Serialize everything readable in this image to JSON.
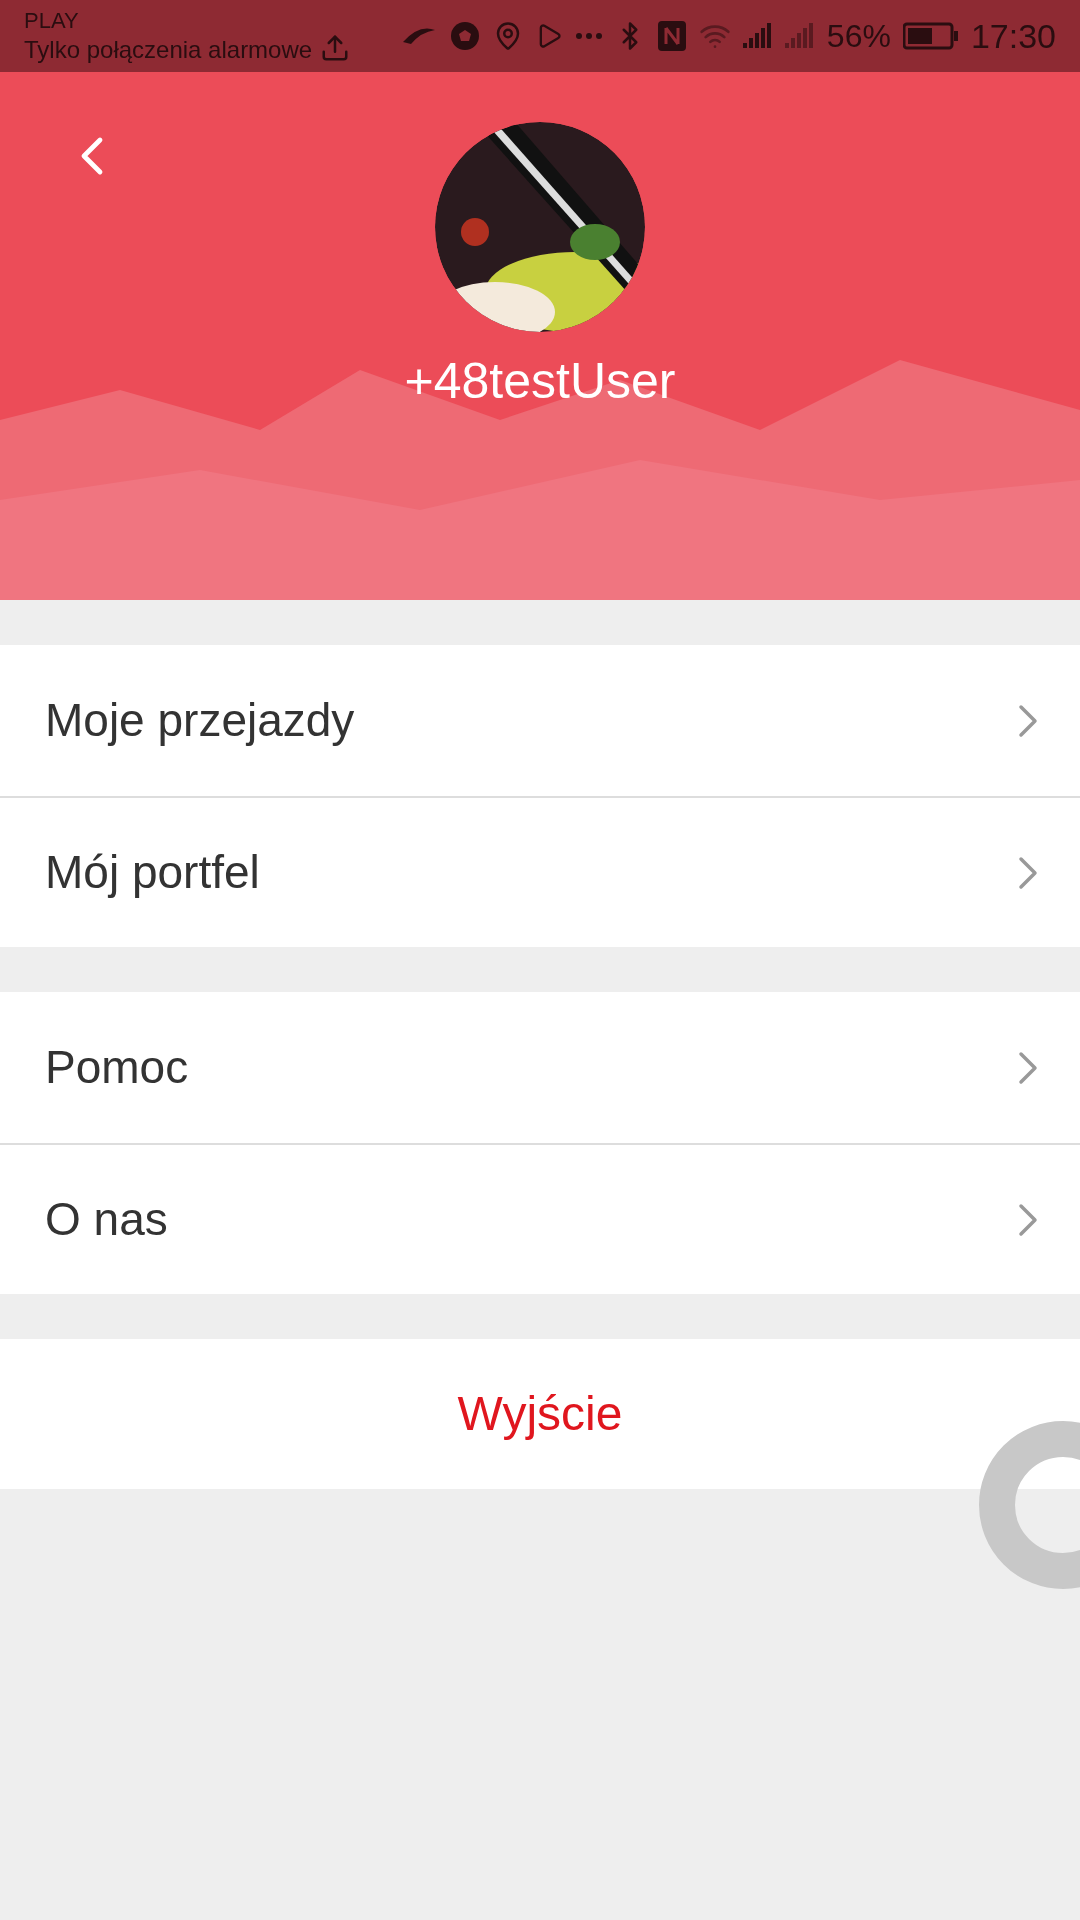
{
  "status_bar": {
    "carrier": "PLAY",
    "network_note": "Tylko połączenia alarmowe",
    "battery": "56%",
    "time": "17:30"
  },
  "profile": {
    "username": "+48testUser"
  },
  "menu_groups": [
    {
      "items": [
        {
          "label": "Moje przejazdy"
        },
        {
          "label": "Mój portfel"
        }
      ]
    },
    {
      "items": [
        {
          "label": "Pomoc"
        },
        {
          "label": "O nas"
        }
      ]
    }
  ],
  "logout": {
    "label": "Wyjście"
  }
}
